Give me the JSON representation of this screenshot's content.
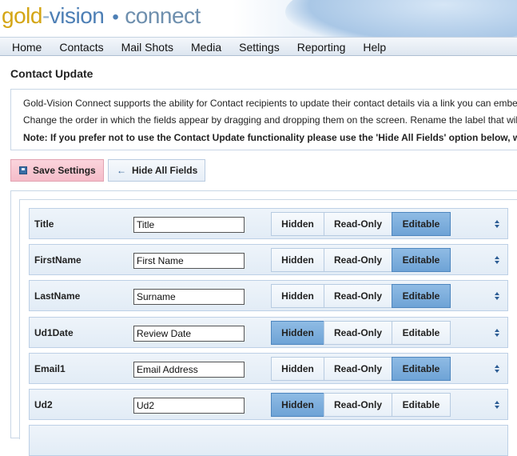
{
  "header": {
    "logo_part1": "gold",
    "logo_dash": "-",
    "logo_part2": "vision",
    "logo_dot": "•",
    "logo_part3": "connect"
  },
  "nav": {
    "items": [
      {
        "label": "Home"
      },
      {
        "label": "Contacts"
      },
      {
        "label": "Mail Shots"
      },
      {
        "label": "Media"
      },
      {
        "label": "Settings"
      },
      {
        "label": "Reporting"
      },
      {
        "label": "Help"
      }
    ]
  },
  "page": {
    "title": "Contact Update",
    "info": {
      "line1": "Gold-Vision Connect supports the ability for Contact recipients to update their contact details via a link you can embe",
      "line2": "Change the order in which the fields appear by dragging and dropping them on the screen. Rename the label that wil",
      "line3": "Note: If you prefer not to use the Contact Update functionality please use the 'Hide All Fields' option below, w"
    }
  },
  "toolbar": {
    "save_label": "Save Settings",
    "save_icon": "disk-icon",
    "hide_label": "Hide All Fields",
    "hide_icon": "arrow-left-icon"
  },
  "options": {
    "hidden": "Hidden",
    "readonly": "Read-Only",
    "editable": "Editable"
  },
  "fields": [
    {
      "name": "Title",
      "label": "Title",
      "state": "editable"
    },
    {
      "name": "FirstName",
      "label": "First Name",
      "state": "editable"
    },
    {
      "name": "LastName",
      "label": "Surname",
      "state": "editable"
    },
    {
      "name": "Ud1Date",
      "label": "Review Date",
      "state": "hidden"
    },
    {
      "name": "Email1",
      "label": "Email Address",
      "state": "editable"
    },
    {
      "name": "Ud2",
      "label": "Ud2",
      "state": "hidden"
    }
  ],
  "colors": {
    "active_segment": "#7aaedc",
    "save_button": "#f7c6d1",
    "logo_gold": "#d4a514",
    "logo_blue": "#4d7fb5"
  }
}
